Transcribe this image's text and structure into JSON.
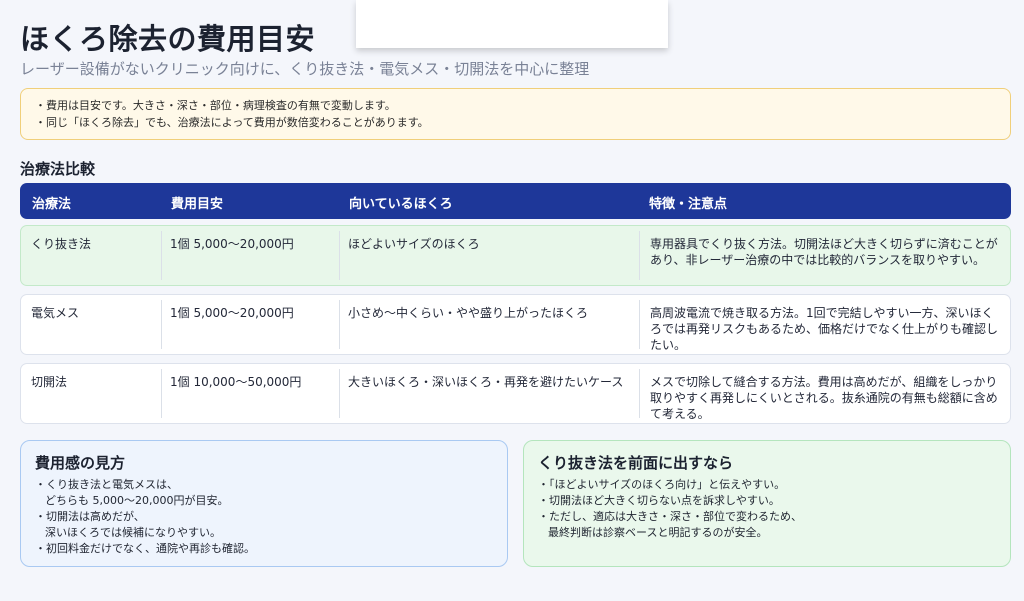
{
  "header": {
    "title": "ほくろ除去の費用目安",
    "subtitle": "レーザー設備がないクリニック向けに、くり抜き法・電気メス・切開法を中心に整理"
  },
  "notice": {
    "lines": [
      "・費用は目安です。大きさ・深さ・部位・病理検査の有無で変動します。",
      "・同じ「ほくろ除去」でも、治療法によって費用が数倍変わることがあります。"
    ]
  },
  "section": {
    "title": "治療法比較"
  },
  "table": {
    "headers": [
      "治療法",
      "費用目安",
      "向いているほくろ",
      "特徴・注意点"
    ],
    "rows": [
      {
        "method": "くり抜き法",
        "cost": "1個 5,000〜20,000円",
        "target": "ほどよいサイズのほくろ",
        "note": "専用器具でくり抜く方法。切開法ほど大きく切らずに済むことがあり、非レーザー治療の中では比較的バランスを取りやすい。"
      },
      {
        "method": "電気メス",
        "cost": "1個 5,000〜20,000円",
        "target": "小さめ〜中くらい・やや盛り上がったほくろ",
        "note": "高周波電流で焼き取る方法。1回で完結しやすい一方、深いほくろでは再発リスクもあるため、価格だけでなく仕上がりも確認したい。"
      },
      {
        "method": "切開法",
        "cost": "1個 10,000〜50,000円",
        "target": "大きいほくろ・深いほくろ・再発を避けたいケース",
        "note": "メスで切除して縫合する方法。費用は高めだが、組織をしっかり取りやすく再発しにくいとされる。抜糸通院の有無も総額に含めて考える。"
      }
    ]
  },
  "cost_box": {
    "title": "費用感の見方",
    "lines": [
      "・くり抜き法と電気メスは、",
      "どちらも 5,000〜20,000円が目安。",
      "・切開法は高めだが、",
      "深いほくろでは候補になりやすい。",
      "・初回料金だけでなく、通院や再診も確認。"
    ]
  },
  "promo_box": {
    "title": "くり抜き法を前面に出すなら",
    "lines": [
      "・「ほどよいサイズのほくろ向け」と伝えやすい。",
      "・切開法ほど大きく切らない点を訴求しやすい。",
      "・ただし、適応は大きさ・深さ・部位で変わるため、",
      "最終判断は診察ベースと明記するのが安全。"
    ]
  },
  "colors": {
    "header_bg": "#1e3799",
    "highlight_row": "#e8f7ea",
    "notice_bg": "#fff9e9",
    "notice_border": "#f0cf7a",
    "cost_box_border": "#a9c9f2",
    "promo_box_border": "#b4e5bd"
  }
}
